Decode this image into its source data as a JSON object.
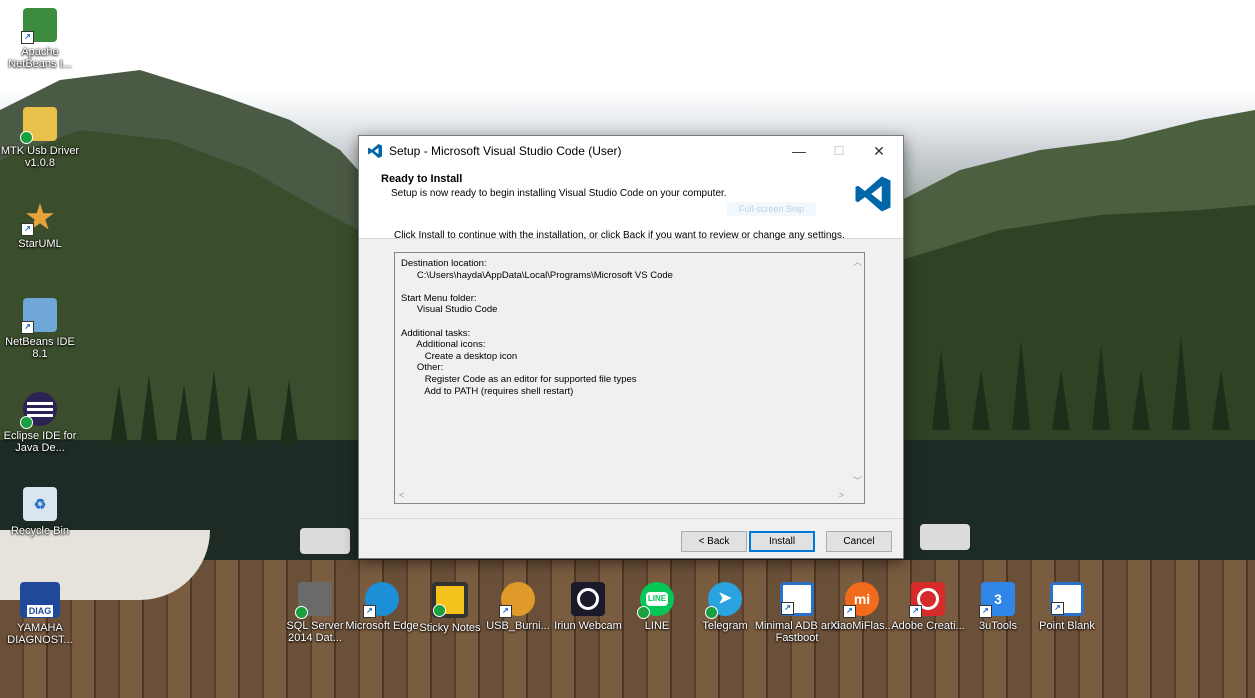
{
  "desktop": {
    "icons_left": [
      {
        "label": "Apache NetBeans I...",
        "icon": "netbeans-cube-icon",
        "color": "#3b8c3e"
      },
      {
        "label": "MTK Usb Driver v1.0.8",
        "icon": "folder-zip-icon",
        "color": "#e8c04a"
      },
      {
        "label": "StarUML",
        "icon": "star-icon",
        "color": "#e8a23a"
      },
      {
        "label": "NetBeans IDE 8.1",
        "icon": "netbeans-cube-icon",
        "color": "#6ea7d8"
      },
      {
        "label": "Eclipse IDE for Java De...",
        "icon": "eclipse-icon",
        "color": "#2c2255"
      },
      {
        "label": "Recycle Bin",
        "icon": "recycle-bin-icon",
        "color": "#d9e6ef"
      },
      {
        "label": "YAMAHA DIAGNOST...",
        "icon": "yamaha-diag-icon",
        "color": "#1f4a9a",
        "badge": "DIAG"
      }
    ],
    "icons_bottom": [
      {
        "label": "SQL Server 2014 Dat...",
        "icon": "sql-server-icon",
        "color": "#6a6a6a"
      },
      {
        "label": "Microsoft Edge",
        "icon": "edge-icon",
        "color": "#1d8fd6"
      },
      {
        "label": "Sticky Notes",
        "icon": "sticky-notes-icon",
        "color": "#f4c21a"
      },
      {
        "label": "USB_Burni...",
        "icon": "usb-burning-icon",
        "color": "#e09a2a"
      },
      {
        "label": "Iriun Webcam",
        "icon": "webcam-icon",
        "color": "#1a1a2a"
      },
      {
        "label": "LINE",
        "icon": "line-icon",
        "color": "#06c755",
        "glyph": "LINE"
      },
      {
        "label": "Telegram",
        "icon": "telegram-icon",
        "color": "#2aa3e0"
      },
      {
        "label": "Minimal ADB and Fastboot",
        "icon": "adb-window-icon",
        "color": "#2a72c8"
      },
      {
        "label": "XiaoMiFlas...",
        "icon": "mi-icon",
        "color": "#f26b1d",
        "glyph": "mi"
      },
      {
        "label": "Adobe Creati...",
        "icon": "adobe-cc-icon",
        "color": "#d62b2b"
      },
      {
        "label": "3uTools",
        "icon": "3utools-icon",
        "color": "#2f86e6"
      },
      {
        "label": "Point Blank",
        "icon": "point-blank-icon",
        "color": "#2a72c8"
      }
    ]
  },
  "dialog": {
    "title": "Setup - Microsoft Visual Studio Code (User)",
    "minimize_glyph": "—",
    "maximize_glyph": "☐",
    "close_glyph": "✕",
    "heading": "Ready to Install",
    "subheading": "Setup is now ready to begin installing Visual Studio Code on your computer.",
    "ghost_text": "Full-screen Snip",
    "instruction": "Click Install to continue with the installation, or click Back if you want to review or change any settings.",
    "memo_lines": [
      "Destination location:",
      "      C:\\Users\\hayda\\AppData\\Local\\Programs\\Microsoft VS Code",
      "",
      "Start Menu folder:",
      "      Visual Studio Code",
      "",
      "Additional tasks:",
      "      Additional icons:",
      "         Create a desktop icon",
      "      Other:",
      "         Register Code as an editor for supported file types",
      "         Add to PATH (requires shell restart)"
    ],
    "memo_text": "",
    "buttons": {
      "back": "< Back",
      "install": "Install",
      "cancel": "Cancel"
    },
    "accent": "#0078d7",
    "vscode_color": "#0065a9"
  }
}
